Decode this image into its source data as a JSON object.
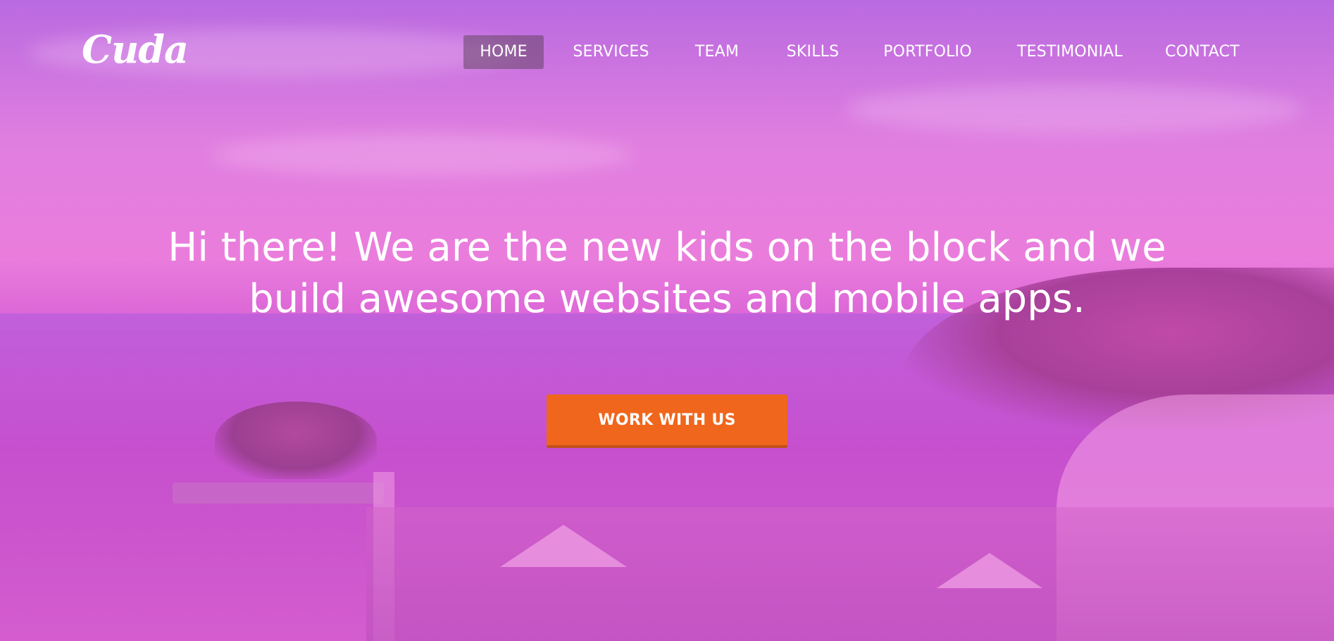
{
  "brand": {
    "logo_text": "Cuda"
  },
  "nav": {
    "items": [
      {
        "label": "HOME",
        "active": true
      },
      {
        "label": "SERVICES",
        "active": false
      },
      {
        "label": "TEAM",
        "active": false
      },
      {
        "label": "SKILLS",
        "active": false
      },
      {
        "label": "PORTFOLIO",
        "active": false
      },
      {
        "label": "TESTIMONIAL",
        "active": false
      },
      {
        "label": "CONTACT",
        "active": false
      }
    ]
  },
  "hero": {
    "headline_line1": "Hi there! We are the new kids on the block and we",
    "headline_line2": "build awesome websites and mobile apps.",
    "cta_label": "WORK WITH US"
  },
  "colors": {
    "overlay": "#e07ee0",
    "cta": "#f0661c",
    "nav_active_bg": "#644664",
    "text": "#ffffff"
  }
}
